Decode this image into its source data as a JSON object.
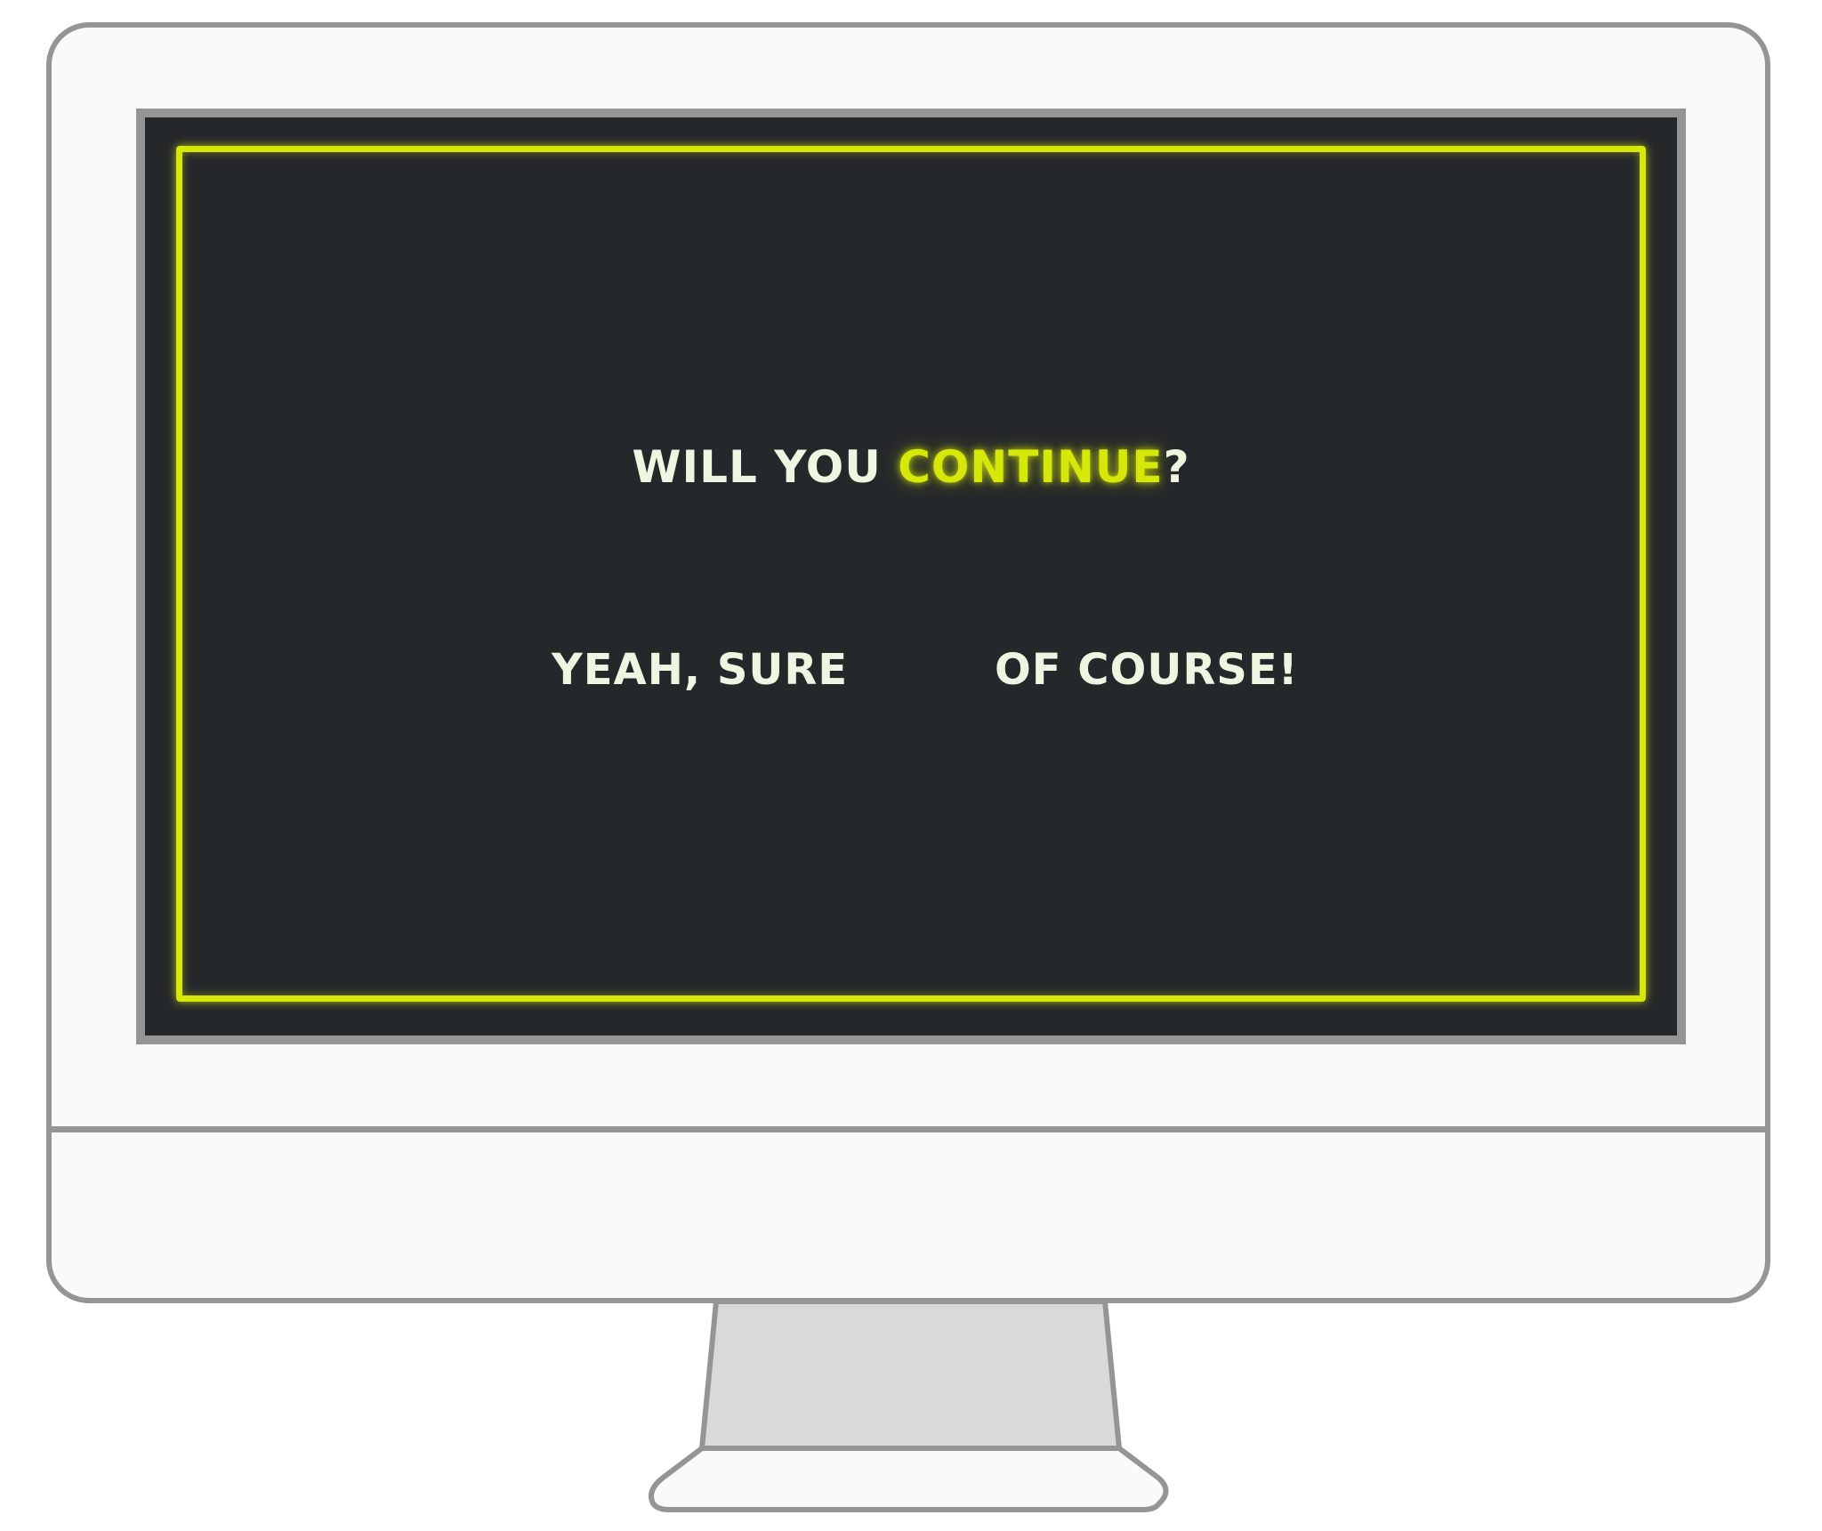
{
  "dialog": {
    "question_prefix": "WILL YOU ",
    "question_accent": "CONTINUE",
    "question_suffix": "?",
    "choices": [
      {
        "label": "YEAH, SURE"
      },
      {
        "label": "OF COURSE!"
      }
    ]
  },
  "colors": {
    "accent": "#d6e80a",
    "screen_background": "#25282a",
    "text": "#eef5e1",
    "device_outline": "#959595",
    "device_body": "#fafafa",
    "stand_neck": "#d9d9d9"
  }
}
